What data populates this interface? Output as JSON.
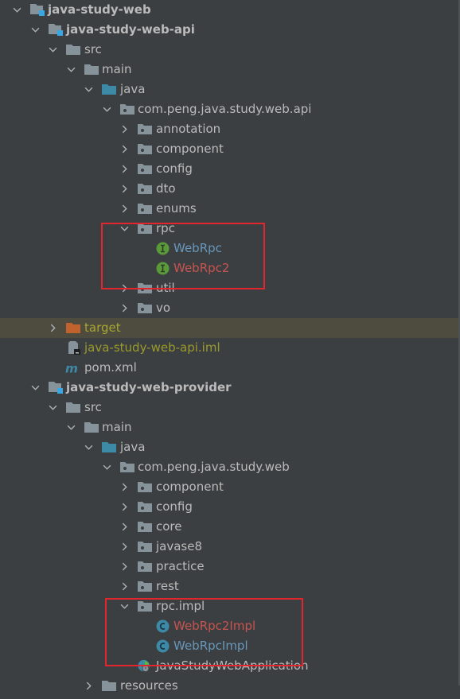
{
  "tree": {
    "colors": {
      "background": "#3c3f41",
      "text": "#bbbbbb",
      "modified_red": "#c75450",
      "added_blue": "#6897bb",
      "ignored_olive": "#9a9a2c",
      "selected_row": "#4e4b3f",
      "folder_gray": "#87939a",
      "source_folder_blue": "#3d8aa7",
      "excluded_orange": "#c0622d",
      "interface_green": "#5a9a3b",
      "class_blue": "#3d89a8",
      "annotation_box_red": "#e3262d"
    },
    "rows": [
      {
        "label": "java-study-web",
        "icon": "module-folder-icon",
        "expanded": true,
        "bold": true
      },
      {
        "label": "java-study-web-api",
        "icon": "module-folder-icon",
        "expanded": true,
        "bold": true
      },
      {
        "label": "src",
        "icon": "folder-icon",
        "expanded": true
      },
      {
        "label": "main",
        "icon": "folder-icon",
        "expanded": true
      },
      {
        "label": "java",
        "icon": "source-folder-icon",
        "expanded": true
      },
      {
        "label": "com.peng.java.study.web.api",
        "icon": "package-icon",
        "expanded": true
      },
      {
        "label": "annotation",
        "icon": "package-icon",
        "expanded": false
      },
      {
        "label": "component",
        "icon": "package-icon",
        "expanded": false
      },
      {
        "label": "config",
        "icon": "package-icon",
        "expanded": false
      },
      {
        "label": "dto",
        "icon": "package-icon",
        "expanded": false
      },
      {
        "label": "enums",
        "icon": "package-icon",
        "expanded": false
      },
      {
        "label": "rpc",
        "icon": "package-icon",
        "expanded": true
      },
      {
        "label": "WebRpc",
        "icon": "interface-icon",
        "status": "added"
      },
      {
        "label": "WebRpc2",
        "icon": "interface-icon",
        "status": "modified"
      },
      {
        "label": "util",
        "icon": "package-icon",
        "expanded": false
      },
      {
        "label": "vo",
        "icon": "package-icon",
        "expanded": false
      },
      {
        "label": "target",
        "icon": "excluded-folder-icon",
        "expanded": false,
        "status": "target",
        "selected": true
      },
      {
        "label": "java-study-web-api.iml",
        "icon": "iml-file-icon",
        "status": "ignored"
      },
      {
        "label": "pom.xml",
        "icon": "maven-icon"
      },
      {
        "label": "java-study-web-provider",
        "icon": "module-folder-icon",
        "expanded": true,
        "bold": true
      },
      {
        "label": "src",
        "icon": "folder-icon",
        "expanded": true
      },
      {
        "label": "main",
        "icon": "folder-icon",
        "expanded": true
      },
      {
        "label": "java",
        "icon": "source-folder-icon",
        "expanded": true
      },
      {
        "label": "com.peng.java.study.web",
        "icon": "package-icon",
        "expanded": true
      },
      {
        "label": "component",
        "icon": "package-icon",
        "expanded": false
      },
      {
        "label": "config",
        "icon": "package-icon",
        "expanded": false
      },
      {
        "label": "core",
        "icon": "package-icon",
        "expanded": false
      },
      {
        "label": "javase8",
        "icon": "package-icon",
        "expanded": false
      },
      {
        "label": "practice",
        "icon": "package-icon",
        "expanded": false
      },
      {
        "label": "rest",
        "icon": "package-icon",
        "expanded": false
      },
      {
        "label": "rpc.impl",
        "icon": "package-icon",
        "expanded": true
      },
      {
        "label": "WebRpc2Impl",
        "icon": "class-icon",
        "status": "modified"
      },
      {
        "label": "WebRpcImpl",
        "icon": "class-icon",
        "status": "added"
      },
      {
        "label": "JavaStudyWebApplication",
        "icon": "spring-boot-app-icon"
      },
      {
        "label": "resources",
        "icon": "folder-icon",
        "expanded": false
      }
    ]
  }
}
